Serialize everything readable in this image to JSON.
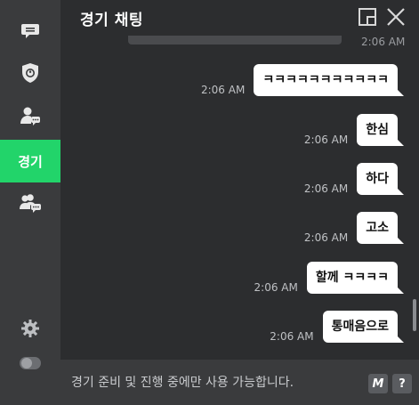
{
  "sidebar": {
    "items": [
      {
        "icon": "chat-bubble-icon"
      },
      {
        "icon": "team-shield-icon"
      },
      {
        "icon": "user-chat-icon"
      },
      {
        "label": "경기",
        "active": true
      },
      {
        "icon": "group-chat-icon"
      }
    ],
    "bottom": [
      {
        "icon": "gear-icon"
      },
      {
        "icon": "toggle-icon"
      }
    ]
  },
  "header": {
    "title": "경기 채팅"
  },
  "chat": {
    "top_partial_time": "2:06 AM",
    "messages": [
      {
        "text": "ㅋㅋㅋㅋㅋㅋㅋㅋㅋㅋㅋ",
        "time": "2:06 AM"
      },
      {
        "text": "한심",
        "time": "2:06 AM"
      },
      {
        "text": "하다",
        "time": "2:06 AM"
      },
      {
        "text": "고소",
        "time": "2:06 AM"
      },
      {
        "text": "할께 ㅋㅋㅋㅋ",
        "time": "2:06 AM"
      },
      {
        "text": "통매음으로",
        "time": "2:06 AM"
      }
    ]
  },
  "footer": {
    "notice": "경기 준비 및 진행 중에만 사용 가능합니다.",
    "m_button": "M",
    "help_button": "?"
  },
  "colors": {
    "accent": "#22d46a",
    "sidebar_bg": "#3a3b3d",
    "main_bg": "#2c2d2f",
    "bubble_bg": "#ffffff"
  }
}
